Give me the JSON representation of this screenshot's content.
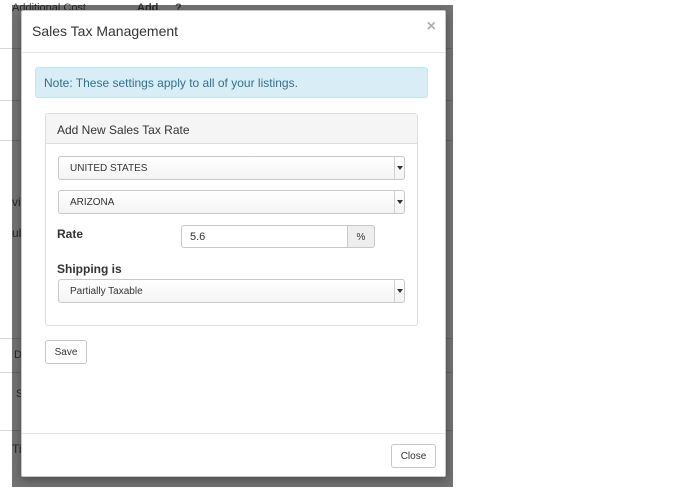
{
  "background": {
    "fragments": [
      "Additional Cost",
      "Add",
      "?",
      "vit",
      "ub",
      "D",
      "S",
      "Ti"
    ]
  },
  "modal": {
    "title": "Sales Tax Management",
    "close_symbol": "×",
    "note": "Note: These settings apply to all of your listings.",
    "panel": {
      "heading": "Add New Sales Tax Rate",
      "country": "UNITED STATES",
      "state": "ARIZONA",
      "rate_label": "Rate",
      "rate_value": "5.6",
      "rate_unit": "%",
      "shipping_label": "Shipping is",
      "shipping_value": "Partially Taxable"
    },
    "save_label": "Save",
    "close_label": "Close"
  },
  "colors": {
    "alert_bg": "#d9edf7",
    "alert_text": "#31708f",
    "backdrop": "#000000"
  }
}
